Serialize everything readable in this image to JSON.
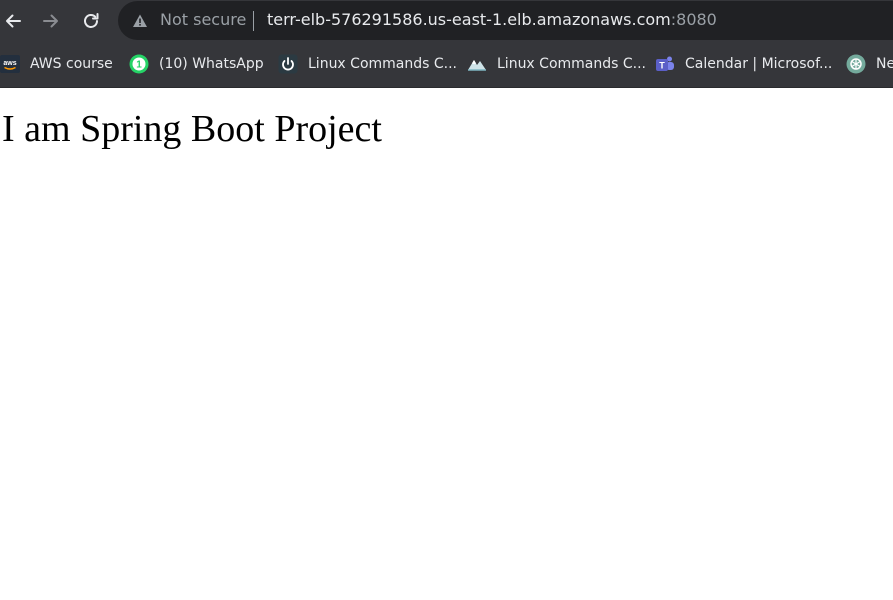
{
  "browser": {
    "address_bar": {
      "security_status": "Not secure",
      "url_host": "terr-elb-576291586.us-east-1.elb.amazonaws.com",
      "url_port": ":8080"
    },
    "bookmarks": [
      {
        "label": "AWS course",
        "icon": "aws-icon"
      },
      {
        "label": "(10) WhatsApp",
        "icon": "whatsapp-icon",
        "badge": "1"
      },
      {
        "label": "Linux Commands C...",
        "icon": "power-icon"
      },
      {
        "label": "Linux Commands C...",
        "icon": "mountain-icon"
      },
      {
        "label": "Calendar | Microsof...",
        "icon": "teams-icon"
      },
      {
        "label": "Ne",
        "icon": "chatgpt-icon"
      }
    ],
    "colors": {
      "toolbar": "#35363a",
      "omnibox": "#202124",
      "whatsapp": "#25d366",
      "teams": "#5b5fc7"
    }
  },
  "page": {
    "heading": "I am Spring Boot Project"
  }
}
